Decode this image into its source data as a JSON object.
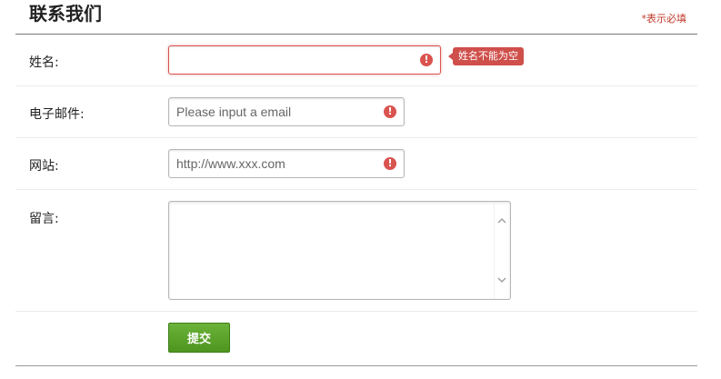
{
  "header": {
    "title": "联系我们",
    "required_note": "*表示必填"
  },
  "form": {
    "name": {
      "label": "姓名:",
      "value": "",
      "placeholder": "",
      "error_tooltip": "姓名不能为空",
      "icon": "alert-icon"
    },
    "email": {
      "label": "电子邮件:",
      "value": "",
      "placeholder": "Please input a email",
      "icon": "alert-icon"
    },
    "website": {
      "label": "网站:",
      "value": "",
      "placeholder": "http://www.xxx.com",
      "icon": "alert-icon"
    },
    "message": {
      "label": "留言:",
      "value": ""
    },
    "submit_label": "提交"
  },
  "colors": {
    "error": "#d9534f",
    "submit_green": "#5ca52c",
    "note_red": "#c0392b"
  }
}
